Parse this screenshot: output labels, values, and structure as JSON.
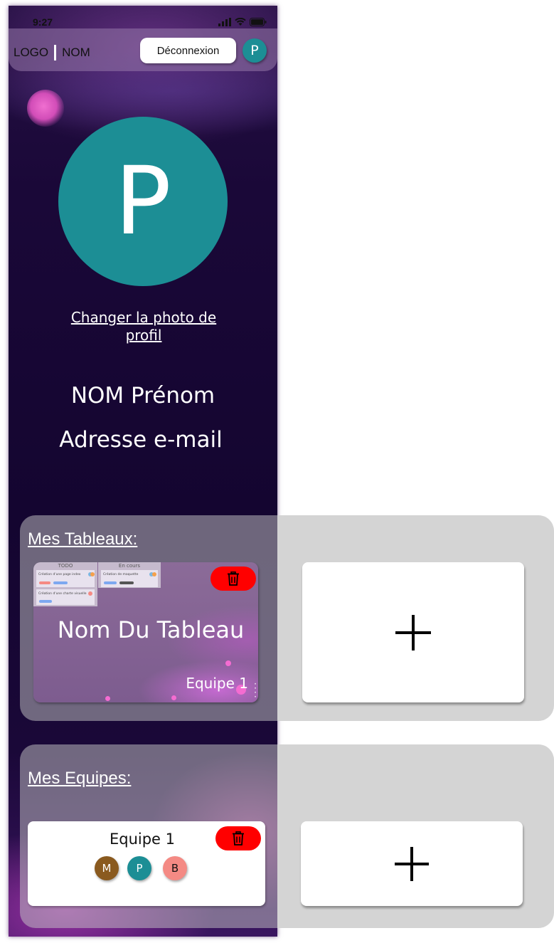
{
  "status_bar": {
    "time": "9:27"
  },
  "header": {
    "logo": "LOGO",
    "name": "NOM",
    "logout_label": "Déconnexion",
    "avatar_initial": "P"
  },
  "profile": {
    "avatar_initial": "P",
    "avatar_color": "#1c8e95",
    "change_photo_label": "Changer la photo de profil",
    "full_name": "NOM Prénom",
    "email": "Adresse e-mail"
  },
  "boards": {
    "title": "Mes Tableaux:",
    "items": [
      {
        "name": "Nom Du Tableau",
        "team": "Equipe 1",
        "preview": {
          "columns": [
            "TODO",
            "En cours"
          ],
          "cards": [
            "Création d'une page index",
            "Création d'une charte visuelle",
            "Création de maquette"
          ]
        }
      }
    ]
  },
  "teams": {
    "title": "Mes Equipes:",
    "items": [
      {
        "name": "Equipe 1",
        "members": [
          {
            "initial": "M",
            "color": "#8a5a1f"
          },
          {
            "initial": "P",
            "color": "#1c8e95"
          },
          {
            "initial": "B",
            "color": "#f48a84"
          }
        ]
      }
    ]
  },
  "colors": {
    "accent": "#1c8e95",
    "delete": "#ff0000",
    "background_dark": "#140530"
  }
}
